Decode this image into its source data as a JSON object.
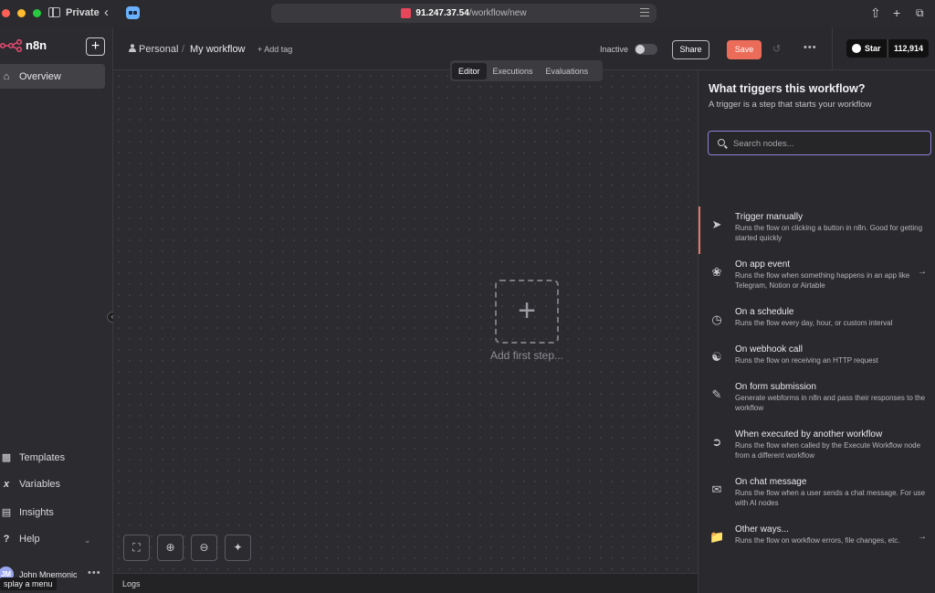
{
  "browser": {
    "private_label": "Private",
    "url_host": "91.247.37.54",
    "url_path": "/workflow/new"
  },
  "sidebar": {
    "logo_text": "n8n",
    "overview_label": "Overview",
    "items": [
      {
        "label": "Templates",
        "icon": "templates-icon"
      },
      {
        "label": "Variables",
        "icon": "variables-icon"
      },
      {
        "label": "Insights",
        "icon": "insights-icon"
      },
      {
        "label": "Help",
        "icon": "help-icon"
      }
    ],
    "user": {
      "initials": "JM",
      "name": "John Mnemonic"
    },
    "tooltip": "splay a menu"
  },
  "header": {
    "breadcrumb_project": "Personal",
    "breadcrumb_sep": "/",
    "workflow_name": "My workflow",
    "add_tag": "+ Add tag",
    "status_label": "Inactive",
    "share_label": "Share",
    "save_label": "Save",
    "github_star_label": "Star",
    "github_star_count": "112,914"
  },
  "tabs": [
    {
      "label": "Editor",
      "active": true
    },
    {
      "label": "Executions",
      "active": false
    },
    {
      "label": "Evaluations",
      "active": false
    }
  ],
  "canvas": {
    "add_first_step": "Add first step...",
    "logs_label": "Logs"
  },
  "panel": {
    "title": "What triggers this workflow?",
    "subtitle": "A trigger is a step that starts your workflow",
    "search_placeholder": "Search nodes...",
    "nodes": [
      {
        "title": "Trigger manually",
        "desc": "Runs the flow on clicking a button in n8n. Good for getting started quickly",
        "icon": "cursor-icon"
      },
      {
        "title": "On app event",
        "desc": "Runs the flow when something happens in an app like Telegram, Notion or Airtable",
        "icon": "satellite-icon"
      },
      {
        "title": "On a schedule",
        "desc": "Runs the flow every day, hour, or custom interval",
        "icon": "clock-icon"
      },
      {
        "title": "On webhook call",
        "desc": "Runs the flow on receiving an HTTP request",
        "icon": "webhook-icon"
      },
      {
        "title": "On form submission",
        "desc": "Generate webforms in n8n and pass their responses to the workflow",
        "icon": "form-icon"
      },
      {
        "title": "When executed by another workflow",
        "desc": "Runs the flow when called by the Execute Workflow node from a different workflow",
        "icon": "sign-in-icon"
      },
      {
        "title": "On chat message",
        "desc": "Runs the flow when a user sends a chat message. For use with AI nodes",
        "icon": "chat-icon"
      },
      {
        "title": "Other ways...",
        "desc": "Runs the flow on workflow errors, file changes, etc.",
        "icon": "folder-icon"
      }
    ]
  }
}
